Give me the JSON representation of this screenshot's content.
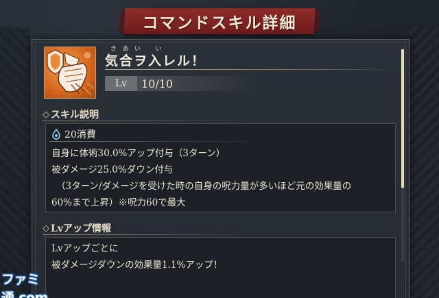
{
  "dialog": {
    "title": "コマンドスキル詳細"
  },
  "skill": {
    "icon_name": "fist-punch-icon",
    "ruby_kiai": [
      "き",
      "あ",
      "い"
    ],
    "ruby_i": "い",
    "name": "気合ヲ入レル！",
    "level_label": "Lv",
    "level_value": "10/10"
  },
  "description_section": {
    "header": "スキル説明",
    "cost_icon_name": "cursed-energy-drop-icon",
    "cost": "20消費",
    "lines": [
      "自身に体術30.0%アップ付与（3ターン）",
      "被ダメージ25.0%ダウン付与",
      "（3ターン/ダメージを受けた時の自身の呪力量が多いほど元の効果量の",
      "60%まで上昇）※呪力60で最大"
    ]
  },
  "levelup_section": {
    "header": "Lvアップ情報",
    "lines": [
      "Lvアップごとに",
      "被ダメージダウンの効果量1.1%アップ！"
    ]
  },
  "watermark": "ファミ通.com",
  "colors": {
    "title_banner": "#8e2a2a",
    "panel_bg": "#2b3038",
    "box_bg": "#1d2127",
    "icon_orange": "#d86a1f",
    "scroll_thumb": "#e6dcc4"
  },
  "scrollbar": {
    "visible_fraction": 0.65,
    "position": 0
  }
}
